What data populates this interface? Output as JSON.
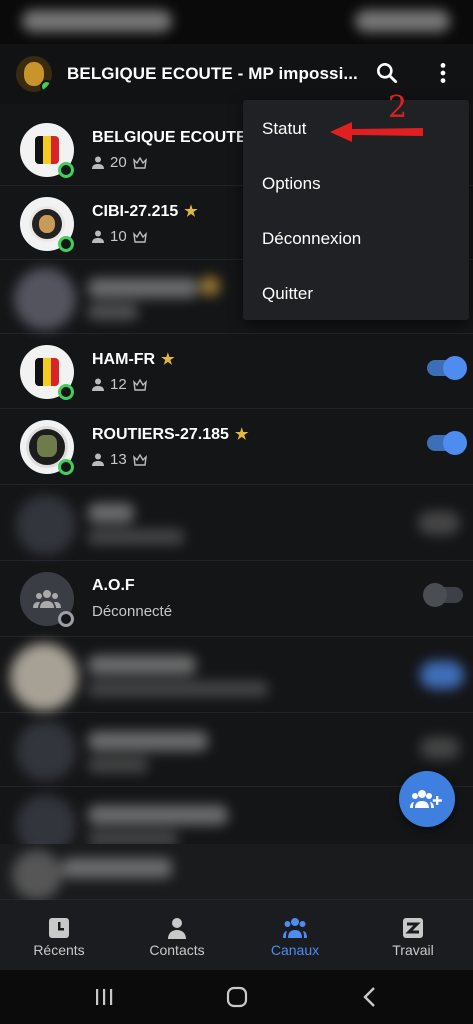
{
  "app_bar": {
    "title": "BELGIQUE ECOUTE - MP impossi..."
  },
  "menu": {
    "items": [
      "Statut",
      "Options",
      "Déconnexion",
      "Quitter"
    ],
    "annotation": "2"
  },
  "channels": [
    {
      "name": "BELGIQUE ECOUTE",
      "starred": true,
      "members": "20"
    },
    {
      "name": "CIBI-27.215",
      "starred": true,
      "members": "10"
    },
    {
      "name": "HAM-FR",
      "starred": true,
      "members": "12",
      "toggle": "on"
    },
    {
      "name": "ROUTIERS-27.185",
      "starred": true,
      "members": "13",
      "toggle": "on"
    },
    {
      "name": "A.O.F",
      "status_text": "Déconnecté",
      "toggle": "off"
    }
  ],
  "bottom_nav": [
    {
      "label": "Récents",
      "icon": "recent-icon"
    },
    {
      "label": "Contacts",
      "icon": "contact-icon"
    },
    {
      "label": "Canaux",
      "icon": "group-icon",
      "active": true
    },
    {
      "label": "Travail",
      "icon": "work-icon"
    }
  ],
  "colors": {
    "accent": "#4e8cf0",
    "online": "#3fcf5a",
    "star": "#e0b840",
    "annotation": "#e02020"
  }
}
